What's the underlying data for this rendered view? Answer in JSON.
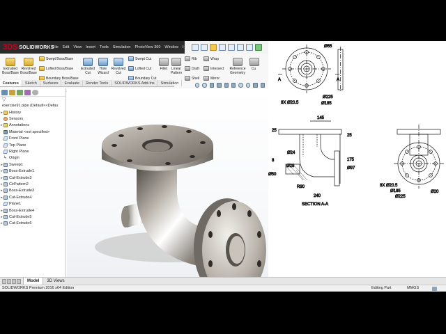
{
  "app": {
    "name": "SOLIDWORKS",
    "logo_prefix": "3DS",
    "brand_color": "#d0021b"
  },
  "menu": [
    "File",
    "Edit",
    "View",
    "Insert",
    "Tools",
    "Simulation",
    "PhotoView 360",
    "Window",
    "Help"
  ],
  "commands": {
    "extruded_boss": "Extruded Boss/Base",
    "revolved_boss": "Revolved Boss/Base",
    "swept_boss": "Swept Boss/Base",
    "lofted_boss": "Lofted Boss/Base",
    "boundary_boss": "Boundary Boss/Base",
    "extruded_cut": "Extruded Cut",
    "hole_wizard": "Hole Wizard",
    "revolved_cut": "Revolved Cut",
    "swept_cut": "Swept Cut",
    "lofted_cut": "Lofted Cut",
    "boundary_cut": "Boundary Cut",
    "fillet": "Fillet",
    "linear_pattern": "Linear Pattern",
    "rib": "Rib",
    "draft": "Draft",
    "shell": "Shell",
    "wrap": "Wrap",
    "intersect": "Intersect",
    "mirror": "Mirror",
    "reference_geometry": "Reference Geometry",
    "curves": "Cu"
  },
  "tabs": [
    {
      "label": "Features",
      "active": true
    },
    {
      "label": "Sketch",
      "active": false
    },
    {
      "label": "Surfaces",
      "active": false
    },
    {
      "label": "Evaluate",
      "active": false
    },
    {
      "label": "Render Tools",
      "active": false
    },
    {
      "label": "SOLIDWORKS Add-Ins",
      "active": false
    },
    {
      "label": "Simulation",
      "active": false
    }
  ],
  "tree": {
    "root": "exercise91 pipe  (Default<<Defau",
    "items": [
      {
        "label": "History",
        "icon": "folder-icon",
        "expandable": true
      },
      {
        "label": "Sensors",
        "icon": "sensor-icon",
        "expandable": false
      },
      {
        "label": "Annotations",
        "icon": "annotation-icon",
        "expandable": true
      },
      {
        "label": "Material <not specified>",
        "icon": "material-icon",
        "expandable": false
      },
      {
        "label": "Front Plane",
        "icon": "plane-icon",
        "expandable": false
      },
      {
        "label": "Top Plane",
        "icon": "plane-icon",
        "expandable": false
      },
      {
        "label": "Right Plane",
        "icon": "plane-icon",
        "expandable": false
      },
      {
        "label": "Origin",
        "icon": "origin-icon",
        "expandable": false
      },
      {
        "label": "Sweep1",
        "icon": "feature-icon",
        "expandable": true
      },
      {
        "label": "Boss-Extrude1",
        "icon": "feature-icon",
        "expandable": true
      },
      {
        "label": "Cut-Extrude3",
        "icon": "feature-icon",
        "expandable": true
      },
      {
        "label": "CirPattern2",
        "icon": "feature-icon",
        "expandable": true
      },
      {
        "label": "Boss-Extrude3",
        "icon": "feature-icon",
        "expandable": true
      },
      {
        "label": "Cut-Extrude4",
        "icon": "feature-icon",
        "expandable": true
      },
      {
        "label": "Plane1",
        "icon": "plane-icon",
        "expandable": false
      },
      {
        "label": "Boss-Extrude4",
        "icon": "feature-icon",
        "expandable": true
      },
      {
        "label": "Cut-Extrude5",
        "icon": "feature-icon",
        "expandable": true
      },
      {
        "label": "Cut-Extrude6",
        "icon": "feature-icon",
        "expandable": true
      }
    ]
  },
  "drawing": {
    "top_view": {
      "d65": "Ø65",
      "d225": "Ø225",
      "d185": "Ø185",
      "holes": "8X Ø20.5",
      "section_a": "A"
    },
    "section": {
      "w145": "145",
      "t25_top": "25",
      "t25_right": "25",
      "h175": "175",
      "d24": "Ø24",
      "t8": "8",
      "d28": "Ø28",
      "d50": "Ø50",
      "d97": "Ø97",
      "r90": "R90",
      "w240": "240",
      "caption": "SECTION A-A"
    },
    "side_view": {
      "holes": "8X Ø20.5",
      "d20": "Ø20",
      "d185": "Ø185",
      "d225": "Ø225"
    }
  },
  "bottom_tabs": [
    {
      "label": "Model",
      "active": true
    },
    {
      "label": "3D Views",
      "active": false
    }
  ],
  "status": {
    "left": "SOLIDWORKS Premium 2016 x64 Edition",
    "mode": "Editing Part",
    "units": "MMGS"
  }
}
